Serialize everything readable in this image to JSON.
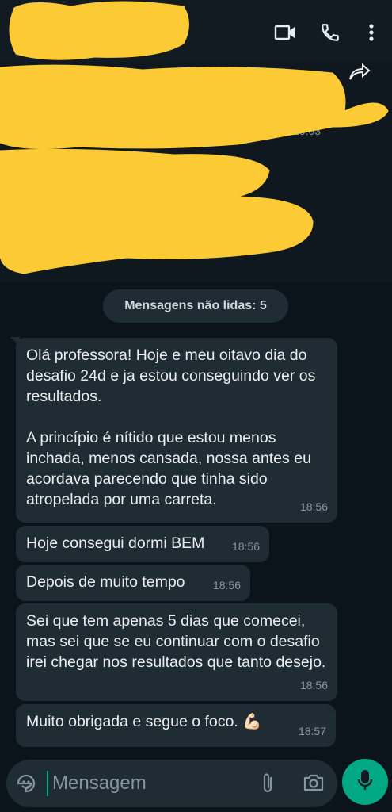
{
  "header": {
    "video_icon": "video-camera-icon",
    "call_icon": "phone-icon",
    "menu_icon": "more-vertical-icon"
  },
  "previous": {
    "time": "15:03"
  },
  "unread_label": "Mensagens não lidas: 5",
  "messages": [
    {
      "text": "Olá professora! Hoje e meu oitavo dia do desafio 24d e ja estou conseguindo ver os resultados.\n\nA princípio é nítido que estou menos inchada, menos cansada, nossa antes eu acordava parecendo que tinha sido atropelada por uma carreta.",
      "time": "18:56"
    },
    {
      "text": "Hoje consegui dormi BEM",
      "time": "18:56"
    },
    {
      "text": "Depois de muito tempo",
      "time": "18:56"
    },
    {
      "text": "Sei que tem apenas 5 dias que comecei, mas sei que se eu continuar com o desafio irei chegar nos resultados que tanto desejo.",
      "time": "18:56"
    },
    {
      "text": "Muito obrigada e segue o foco. 💪🏻",
      "time": "18:57"
    }
  ],
  "composer": {
    "placeholder": "Mensagem"
  },
  "colors": {
    "background": "#0b141a",
    "bubble": "#202c33",
    "accent": "#00a884",
    "redaction": "#fcca34"
  }
}
